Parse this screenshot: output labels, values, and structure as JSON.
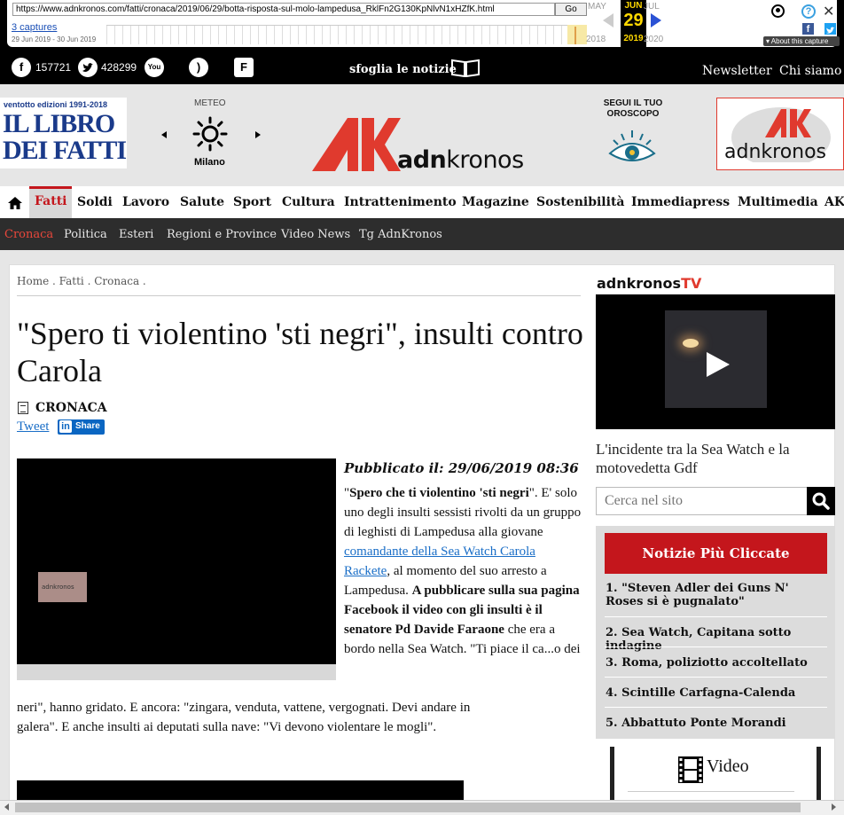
{
  "wayback": {
    "url": "https://www.adnkronos.com/fatti/cronaca/2019/06/29/botta-risposta-sul-molo-lampedusa_RklFn2G130KpNlvN1xHZfK.html",
    "go_label": "Go",
    "captures": "3 captures",
    "range": "29 Jun 2019 - 30 Jun 2019",
    "prev_month": "MAY",
    "cur_month": "JUN",
    "next_month": "JUL",
    "cur_day": "29",
    "prev_year": "2018",
    "cur_year": "2019",
    "next_year": "2020",
    "about": "▾ About this capture",
    "help": "?",
    "close": "✕",
    "fb": "f"
  },
  "social": {
    "facebook_count": "157721",
    "twitter_count": "428299",
    "sfoglia": "sfoglia le notizie",
    "newsletter": "Newsletter",
    "chi_siamo": "Chi siamo",
    "fb_glyph": "f",
    "yt_glyph": "You",
    "rss_glyph": ")",
    "flip_glyph": "F"
  },
  "header": {
    "libro_top": "ventotto edizioni 1991-2018",
    "libro_main": "IL LIBRO DEI FATTI",
    "meteo_label": "METEO",
    "meteo_city": "Milano",
    "brand_prefix": "adn",
    "brand_suffix": "kronos",
    "oroscopo": "SEGUI IL TUO OROSCOPO",
    "box_brand": "adnkronos"
  },
  "nav": {
    "items": [
      "Fatti",
      "Soldi",
      "Lavoro",
      "Salute",
      "Sport",
      "Cultura",
      "Intrattenimento",
      "Magazine",
      "Sostenibilità",
      "Immediapress",
      "Multimedia",
      "AK"
    ],
    "active_color": "#c4161c"
  },
  "subnav": {
    "items": [
      "Cronaca",
      "Politica",
      "Esteri",
      "Regioni e Province",
      "Video News",
      "Tg AdnKronos"
    ],
    "active_color": "#e8473b"
  },
  "article": {
    "breadcrumb": "Home . Fatti . Cronaca .",
    "title": "\"Spero ti violentino 'sti negri\", insulti contro Carola",
    "section": "CRONACA",
    "tweet": "Tweet",
    "share": "Share",
    "published": "Pubblicato il: 29/06/2019 08:36",
    "video_watermark": "adnkronos",
    "p1_open_quote": "\"",
    "p1_bold": "Spero che ti violentino 'sti negri",
    "p1_text": "\". E' solo uno degli insulti sessisti rivolti da un gruppo di leghisti di Lampedusa alla giovane ",
    "p1_link": "comandante della Sea Watch Carola Rackete",
    "p1_text2": ", al momento del suo arresto a Lampedusa. ",
    "p1_bold2": "A pubblicare sulla sua pagina Facebook il video con gli insulti è il senatore Pd Davide Faraone",
    "p1_text3": " che era a bordo nella Sea Watch. \"Ti piace il ca...o dei",
    "p1_line_wide1": "neri\", hanno gridato. E ancora: \"zingara, venduta, vattene, vergognati. Devi andare in",
    "p1_line_wide2": "galera\". E anche insulti ai deputati sulla nave: \"Vi devono violentare le mogli\"."
  },
  "sidebar": {
    "tv_brand": "adnkronos",
    "tv_suffix": "TV",
    "tv_caption": "L'incidente tra la Sea Watch e la motovedetta Gdf",
    "search_placeholder": "Cerca nel sito",
    "top_title": "Notizie Più Cliccate",
    "top_items": [
      "1. \"Steven Adler dei Guns N' Roses si è pugnalato\"",
      "2. Sea Watch, Capitana sotto indagine",
      "3. Roma, poliziotto accoltellato",
      "4. Scintille Carfagna-Calenda",
      "5. Abbattuto Ponte Morandi"
    ],
    "video_label": "Video"
  },
  "colors": {
    "brand_red": "#e03a2e",
    "link_blue": "#1a6ec7"
  }
}
